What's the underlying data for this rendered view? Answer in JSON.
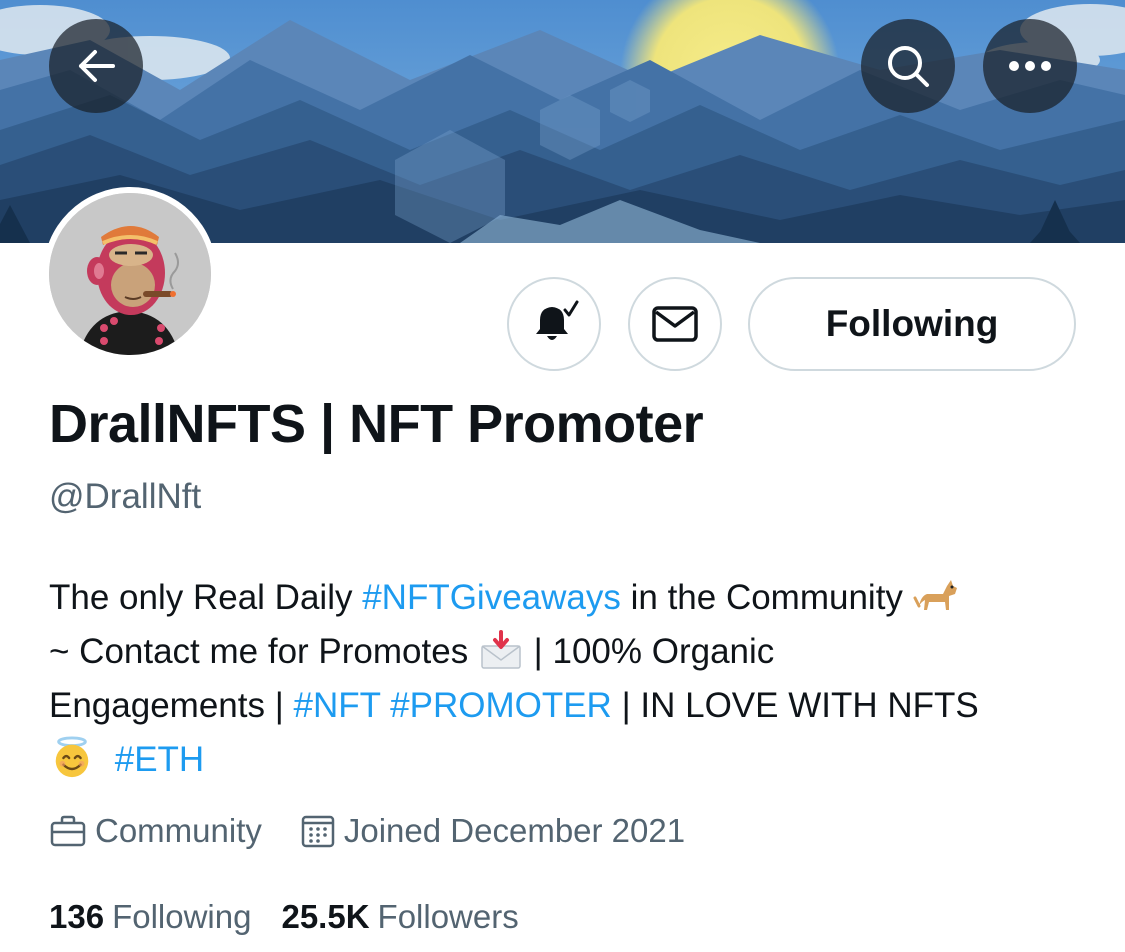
{
  "header": {
    "back_icon": "arrow-left-icon",
    "search_icon": "search-icon",
    "more_icon": "more-horizontal-icon"
  },
  "actions": {
    "notify_icon": "bell-check-icon",
    "message_icon": "envelope-icon",
    "following_label": "Following"
  },
  "profile": {
    "name": "DrallNFTS | NFT Promoter",
    "handle": "@DrallNft",
    "bio": {
      "l1_a": "The only Real Daily ",
      "l1_tag": "#NFTGiveaways",
      "l1_b": " in the Community",
      "l2_a": "~ Contact me for Promotes",
      "l2_b": " | 100% Organic",
      "l3_a": "Engagements | ",
      "l3_tag1": "#NFT",
      "l3_tag2": "#PROMOTER",
      "l3_b": " | IN LOVE WITH NFTS",
      "l4_tag": "#ETH"
    },
    "category": "Community",
    "joined": "Joined December 2021"
  },
  "stats": {
    "following_count": "136",
    "following_label": "Following",
    "followers_count": "25.5K",
    "followers_label": "Followers"
  },
  "colors": {
    "link": "#1d9bf0",
    "secondary_text": "#536471",
    "primary_text": "#0f1419",
    "button_border": "#cfd9de"
  }
}
